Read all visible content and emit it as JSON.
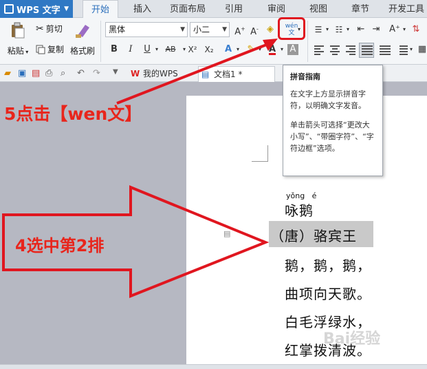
{
  "app": {
    "title": "WPS 文字"
  },
  "menu_tabs": [
    {
      "label": "开始",
      "active": true
    },
    {
      "label": "插入"
    },
    {
      "label": "页面布局"
    },
    {
      "label": "引用"
    },
    {
      "label": "审阅"
    },
    {
      "label": "视图"
    },
    {
      "label": "章节"
    },
    {
      "label": "开发工具"
    }
  ],
  "ribbon": {
    "paste": "粘贴",
    "cut": "剪切",
    "copy": "复制",
    "format_painter": "格式刷",
    "font_name": "黑体",
    "font_size": "小二",
    "bold": "B",
    "italic": "I",
    "underline": "U",
    "strike": "AB",
    "superscript": "X²",
    "subscript": "X₂",
    "font_color_letter": "A",
    "pinyin_button": "wén文"
  },
  "doc_tabs": [
    {
      "label": "我的WPS"
    },
    {
      "label": "文档1 *"
    }
  ],
  "tooltip": {
    "title": "拼音指南",
    "line1": "在文字上方显示拼音字符，以明确文字发音。",
    "line2": "单击箭头可选择“更改大小写”、“带圈字符”、“字符边框”选项。"
  },
  "document": {
    "pinyin": "yǒng   é",
    "lines": [
      "咏鹅",
      "（唐）骆宾王",
      "鹅，鹅，鹅，",
      "曲项向天歌。",
      "白毛浮绿水，",
      "红掌拨清波。"
    ]
  },
  "annotations": {
    "step5": "5点击【wen文】",
    "step4": "4选中第2排"
  },
  "watermark": "Bai经验",
  "colors": {
    "accent": "#2f78c4",
    "annotation": "#e0161f"
  }
}
